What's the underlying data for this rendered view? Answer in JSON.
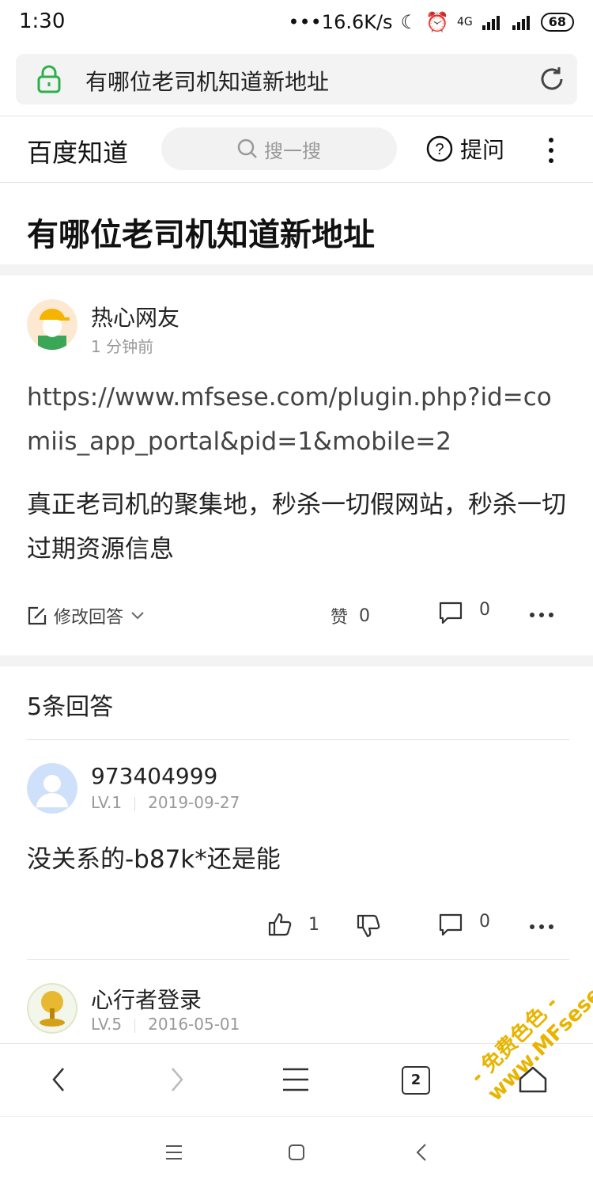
{
  "status_bar": {
    "time": "1:30",
    "speed": "•••16.6K/s",
    "network": "4G",
    "battery": "68"
  },
  "url_bar": {
    "url": "有哪位老司机知道新地址"
  },
  "site_header": {
    "logo": "百度知道",
    "search_placeholder": "搜一搜",
    "ask_label": "提问"
  },
  "question": {
    "title": "有哪位老司机知道新地址",
    "author": "热心网友",
    "time": "1 分钟前",
    "url_text": "https://www.mfsese.com/plugin.php?id=comiis_app_portal&pid=1&mobile=2",
    "body": "真正老司机的聚集地，秒杀一切假网站，秒杀一切过期资源信息",
    "edit_label": "修改回答",
    "like_label": "赞",
    "like_count": "0",
    "comment_count": "0"
  },
  "answers": {
    "header": "5条回答",
    "items": [
      {
        "user": "973404999",
        "level": "LV.1",
        "date": "2019-09-27",
        "text": "没关系的-b87k*还是能",
        "like_count": "1",
        "comment_count": "0"
      },
      {
        "user": "心行者登录",
        "level": "LV.5",
        "date": "2016-05-01"
      }
    ]
  },
  "browser_nav": {
    "tabs_count": "2"
  },
  "watermark": {
    "text": "- 免费色色 - www.MFsese.com"
  },
  "colors": {
    "lock": "#2db04b",
    "watermark": "#e8b400"
  }
}
